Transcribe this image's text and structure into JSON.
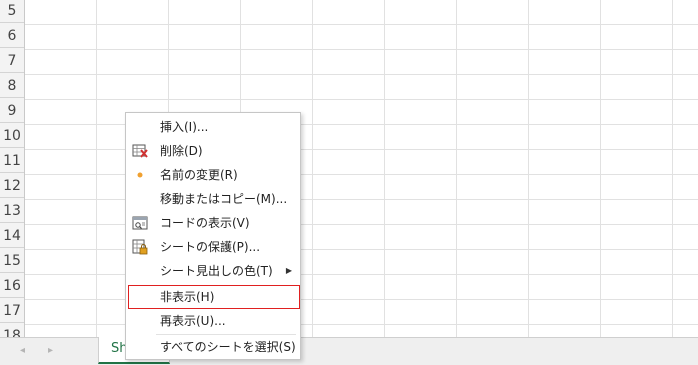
{
  "row_headers": [
    "5",
    "6",
    "7",
    "8",
    "9",
    "10",
    "11",
    "12",
    "13",
    "14",
    "15",
    "16",
    "17",
    "18"
  ],
  "sheet_tab": {
    "label": "Sh"
  },
  "tab_nav": {
    "prev": "◂",
    "next": "▸"
  },
  "context_menu": {
    "items": [
      {
        "label": "挿入(I)...",
        "icon": "none"
      },
      {
        "label": "削除(D)",
        "icon": "delete-sheet-icon"
      },
      {
        "label": "名前の変更(R)",
        "icon": "dot-icon"
      },
      {
        "label": "移動またはコピー(M)...",
        "icon": "none"
      },
      {
        "label": "コードの表示(V)",
        "icon": "view-code-icon"
      },
      {
        "label": "シートの保護(P)...",
        "icon": "protect-sheet-icon"
      },
      {
        "label": "シート見出しの色(T)",
        "icon": "none",
        "submenu_arrow": "▶"
      },
      {
        "label": "非表示(H)",
        "icon": "none",
        "highlighted": true
      },
      {
        "label": "再表示(U)...",
        "icon": "none"
      },
      {
        "label": "すべてのシートを選択(S)",
        "icon": "none"
      }
    ]
  },
  "colors": {
    "accent": "#217346",
    "highlight_border": "#e02020",
    "dot": "#f0a030"
  }
}
